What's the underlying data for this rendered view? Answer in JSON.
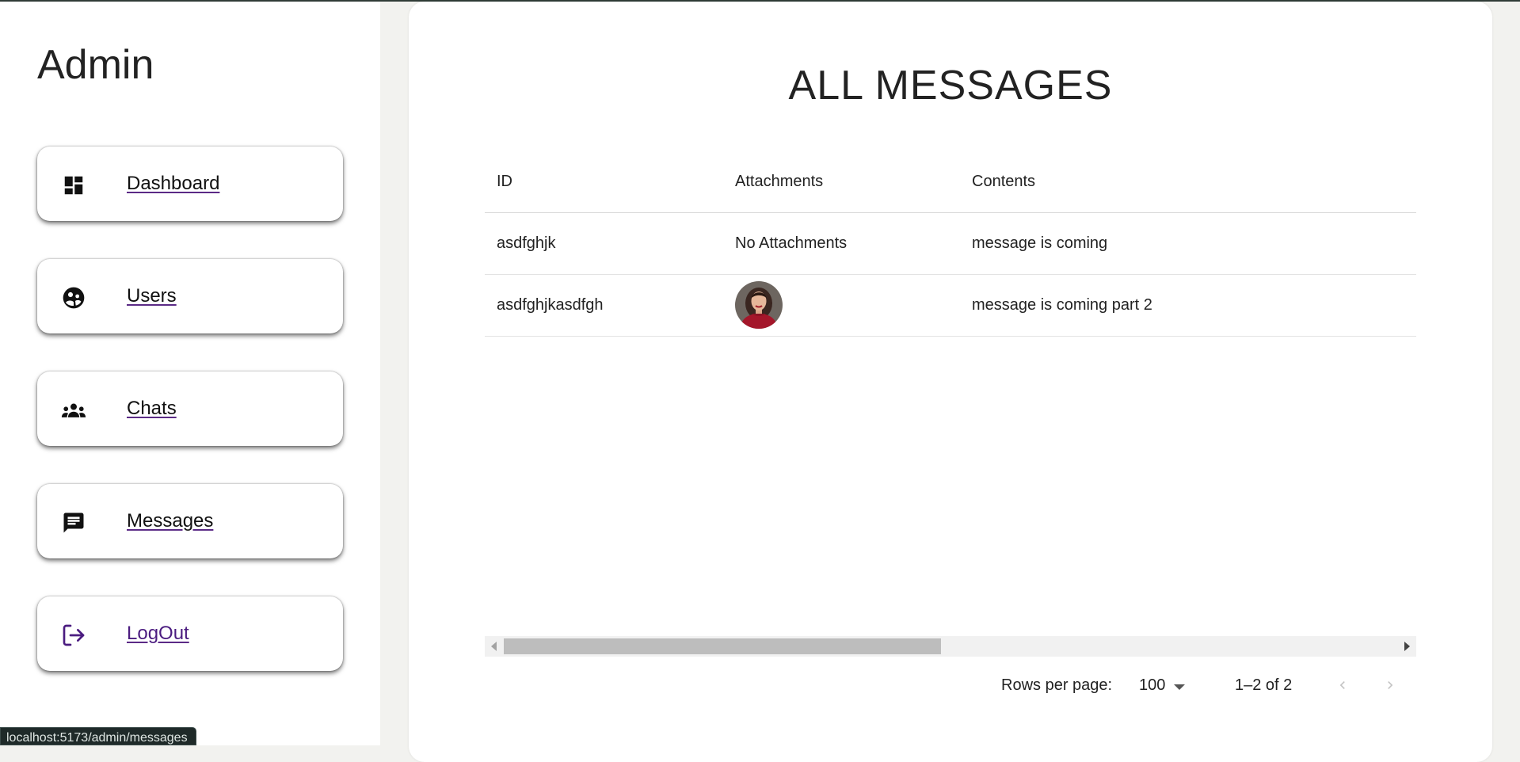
{
  "sidebar": {
    "title": "Admin",
    "items": [
      {
        "label": "Dashboard",
        "icon": "dashboard-icon"
      },
      {
        "label": "Users",
        "icon": "users-icon"
      },
      {
        "label": "Chats",
        "icon": "group-icon"
      },
      {
        "label": "Messages",
        "icon": "chat-icon"
      },
      {
        "label": "LogOut",
        "icon": "logout-icon"
      }
    ]
  },
  "main": {
    "title": "ALL MESSAGES",
    "table": {
      "columns": [
        "ID",
        "Attachments",
        "Contents"
      ],
      "rows": [
        {
          "id": "asdfghjk",
          "attachments": "No Attachments",
          "contents": "message is coming"
        },
        {
          "id": "asdfghjkasdfgh",
          "attachments": "",
          "contents": "message is coming part 2"
        }
      ]
    },
    "pagination": {
      "rows_per_page_label": "Rows per page:",
      "rows_per_page": "100",
      "range": "1–2 of 2"
    }
  },
  "statusbar": {
    "url": "localhost:5173/admin/messages"
  },
  "colors": {
    "accent": "#4b1c80",
    "background": "#f2f2ef"
  }
}
